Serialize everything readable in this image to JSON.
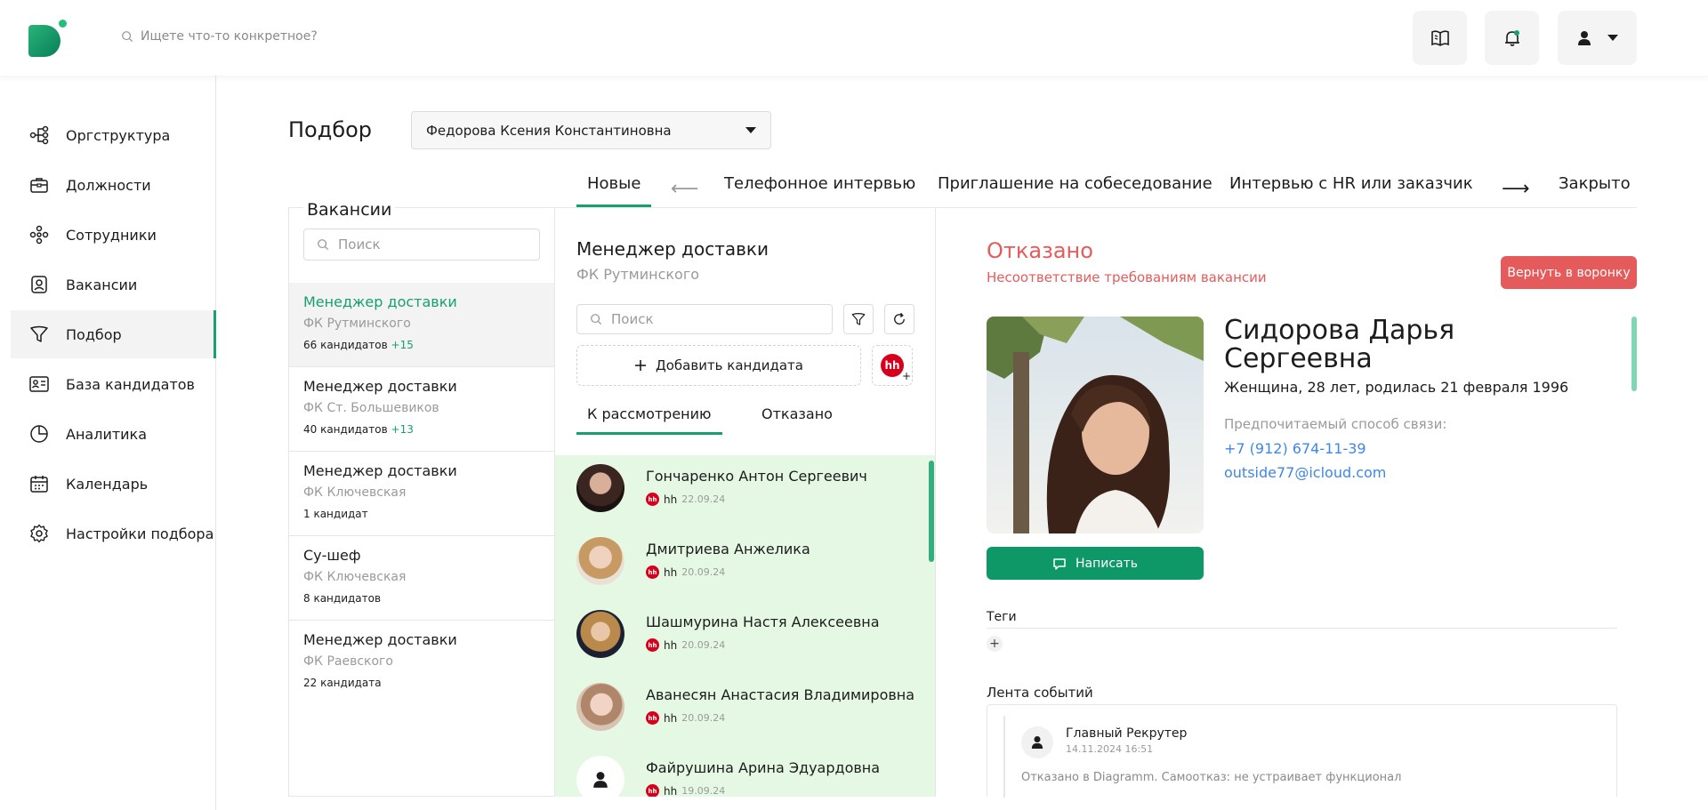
{
  "header": {
    "search_placeholder": "Ищете что-то конкретное?"
  },
  "sidebar": {
    "items": [
      {
        "label": "Оргструктура",
        "icon": "org-structure-icon",
        "active": false
      },
      {
        "label": "Должности",
        "icon": "briefcase-icon",
        "active": false
      },
      {
        "label": "Сотрудники",
        "icon": "people-icon",
        "active": false
      },
      {
        "label": "Вакансии",
        "icon": "badge-icon",
        "active": false
      },
      {
        "label": "Подбор",
        "icon": "funnel-icon",
        "active": true
      },
      {
        "label": "База кандидатов",
        "icon": "contact-card-icon",
        "active": false
      },
      {
        "label": "Аналитика",
        "icon": "pie-chart-icon",
        "active": false
      },
      {
        "label": "Календарь",
        "icon": "calendar-icon",
        "active": false
      },
      {
        "label": "Настройки подбора",
        "icon": "gear-icon",
        "active": false
      }
    ]
  },
  "page": {
    "title": "Подбор",
    "recruiter_select": "Федорова Ксения Константиновна"
  },
  "stages": {
    "items": [
      "Новые",
      "Телефонное интервью",
      "Приглашение на собеседование",
      "Интервью с HR или заказчик",
      "Закрыто"
    ],
    "arrow_left": "⟵",
    "arrow_right": "⟶"
  },
  "vacancies": {
    "title": "Вакансии",
    "search_placeholder": "Поиск",
    "items": [
      {
        "name": "Менеджер доставки",
        "club": "ФК Рутминского",
        "count": "66 кандидатов",
        "plus": "+15",
        "active": true
      },
      {
        "name": "Менеджер доставки",
        "club": "ФК Ст. Большевиков",
        "count": "40 кандидатов",
        "plus": "+13",
        "active": false
      },
      {
        "name": "Менеджер доставки",
        "club": "ФК Ключевская",
        "count": "1 кандидат",
        "plus": "",
        "active": false
      },
      {
        "name": "Су-шеф",
        "club": "ФК Ключевская",
        "count": "8 кандидатов",
        "plus": "",
        "active": false
      },
      {
        "name": "Менеджер доставки",
        "club": "ФК Раевского",
        "count": "22 кандидата",
        "plus": "",
        "active": false
      }
    ]
  },
  "candidates": {
    "title": "Менеджер доставки",
    "subtitle": "ФК Рутминского",
    "search_placeholder": "Поиск",
    "add_label": "Добавить кандидата",
    "hh_badge": "hh",
    "hh_plus": "+",
    "tabs": [
      "К рассмотрению",
      "Отказано"
    ],
    "items": [
      {
        "name": "Гончаренко Антон Сергеевич",
        "source": "hh",
        "date": "22.09.24"
      },
      {
        "name": "Дмитриева Анжелика",
        "source": "hh",
        "date": "20.09.24"
      },
      {
        "name": "Шашмурина Настя Алексеевна",
        "source": "hh",
        "date": "20.09.24"
      },
      {
        "name": "Аванесян Анастасия Владимировна",
        "source": "hh",
        "date": "20.09.24"
      },
      {
        "name": "Файрушина Арина Эдуардовна",
        "source": "hh",
        "date": "19.09.24"
      }
    ]
  },
  "detail": {
    "status": "Отказано",
    "reason": "Несоответствие требованиям вакансии",
    "return_button": "Вернуть в воронку",
    "name": "Сидорова Дарья Сергеевна",
    "info": "Женщина, 28 лет, родилась 21 февраля 1996",
    "contact_label": "Предпочитаемый способ связи:",
    "phone": "+7 (912) 674-11-39",
    "email": "outside77@icloud.com",
    "write_button": "Написать",
    "tags_label": "Теги",
    "tags_add": "+",
    "feed_label": "Лента событий",
    "feed": [
      {
        "author": "Главный Рекрутер",
        "time": "14.11.2024 16:51",
        "text": "Отказано в Diagramm. Самоотказ: не устраивает функционал"
      }
    ]
  },
  "colors": {
    "accent": "#16a06f",
    "danger": "#e55b5b",
    "link": "#3f86e6",
    "selected_list_bg": "#e4f8e4"
  }
}
